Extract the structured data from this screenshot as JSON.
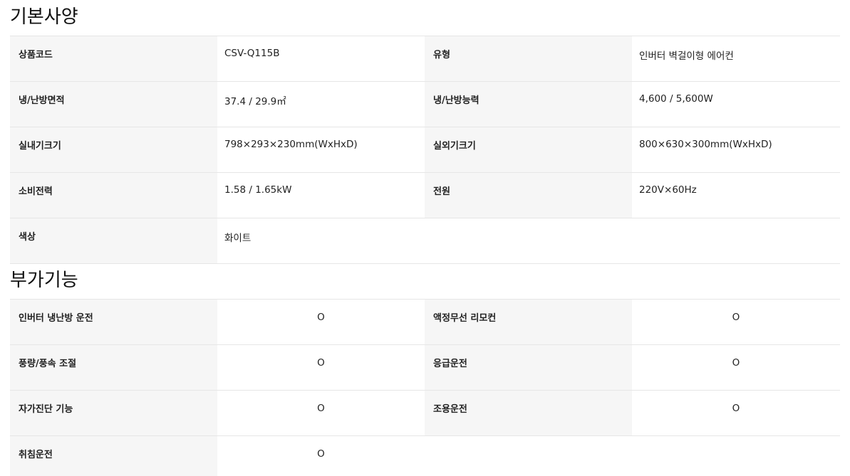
{
  "basic": {
    "title": "기본사양",
    "rows": [
      {
        "k1": "상품코드",
        "v1": "CSV-Q115B",
        "k2": "유형",
        "v2": "인버터 벽걸이형 에어컨"
      },
      {
        "k1": "냉/난방면적",
        "v1": "37.4 / 29.9㎡",
        "k2": "냉/난방능력",
        "v2": "4,600 / 5,600W"
      },
      {
        "k1": "실내기크기",
        "v1": "798×293×230mm(WxHxD)",
        "k2": "실외기크기",
        "v2": "800×630×300mm(WxHxD)"
      },
      {
        "k1": "소비전력",
        "v1": "1.58 / 1.65kW",
        "k2": "전원",
        "v2": "220V×60Hz"
      },
      {
        "k1": "색상",
        "v1": "화이트"
      }
    ]
  },
  "extra": {
    "title": "부가기능",
    "rows": [
      {
        "k1": "인버터 냉난방 운전",
        "v1": "O",
        "k2": "액정무선 리모컨",
        "v2": "O"
      },
      {
        "k1": "풍량/풍속 조절",
        "v1": "O",
        "k2": "응급운전",
        "v2": "O"
      },
      {
        "k1": "자가진단 기능",
        "v1": "O",
        "k2": "조용운전",
        "v2": "O"
      },
      {
        "k1": "취침운전",
        "v1": "O"
      }
    ]
  }
}
